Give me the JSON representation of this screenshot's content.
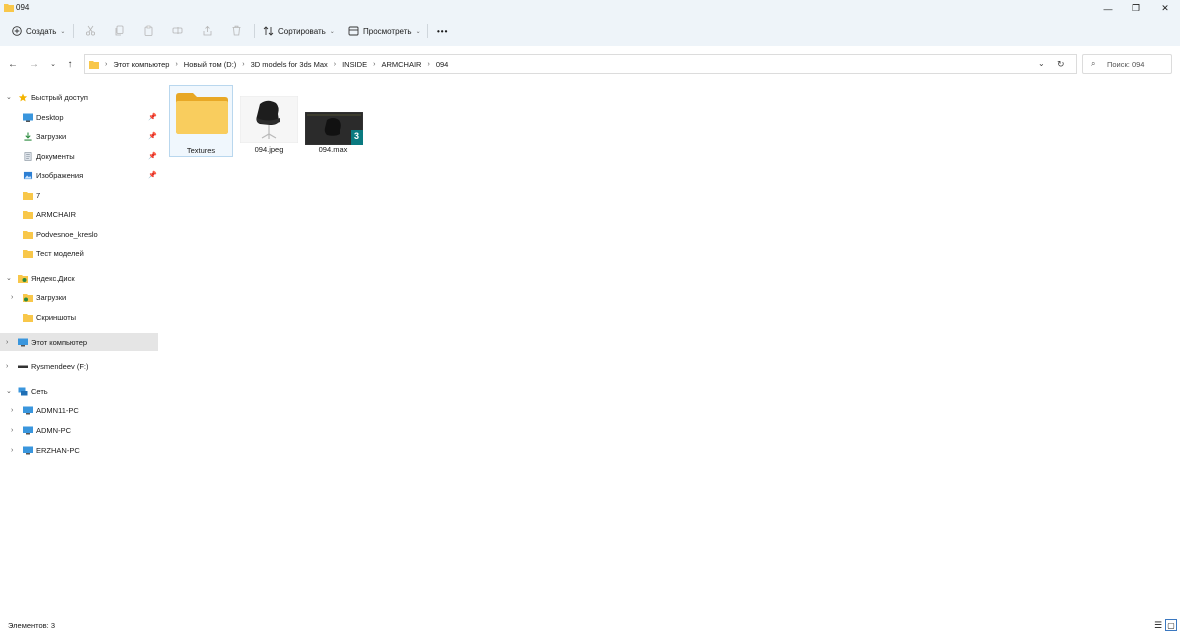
{
  "window": {
    "title": "094",
    "controls": {
      "minimize": "—",
      "maximize": "❐",
      "close": "✕"
    }
  },
  "toolbar": {
    "create_label": "Создать",
    "sort_label": "Сортировать",
    "view_label": "Просмотреть",
    "more_label": "•••"
  },
  "address": {
    "breadcrumbs": [
      "Этот компьютер",
      "Новый том (D:)",
      "3D models for 3ds Max",
      "INSIDE",
      "ARMCHAIR",
      "094"
    ],
    "separator": "›"
  },
  "search": {
    "placeholder": "Поиск: 094"
  },
  "sidebar": {
    "quick_access": "Быстрый доступ",
    "pinned": [
      "Desktop",
      "Загрузки",
      "Документы",
      "Изображения"
    ],
    "folders": [
      "7",
      "ARMCHAIR",
      "Podvesnoe_kreslo",
      "Тест моделей"
    ],
    "yandex": "Яндекс.Диск",
    "yandex_items": [
      "Загрузки",
      "Скриншоты"
    ],
    "this_pc": "Этот компьютер",
    "drive": "Rysmendeev (F:)",
    "network": "Сеть",
    "network_items": [
      "ADMN11-PC",
      "ADMN-PC",
      "ERZHAN-PC"
    ]
  },
  "files": [
    {
      "name": "Textures",
      "kind": "folder-icon"
    },
    {
      "name": "094.jpeg",
      "kind": "image-thumbnail"
    },
    {
      "name": "094.max",
      "kind": "3dsmax-thumbnail",
      "badge": "3"
    }
  ],
  "status": {
    "text": "Элементов: 3"
  },
  "colors": {
    "accent": "#0067c0",
    "folder": "#f8c74a",
    "selection": "#e5e5e5"
  }
}
